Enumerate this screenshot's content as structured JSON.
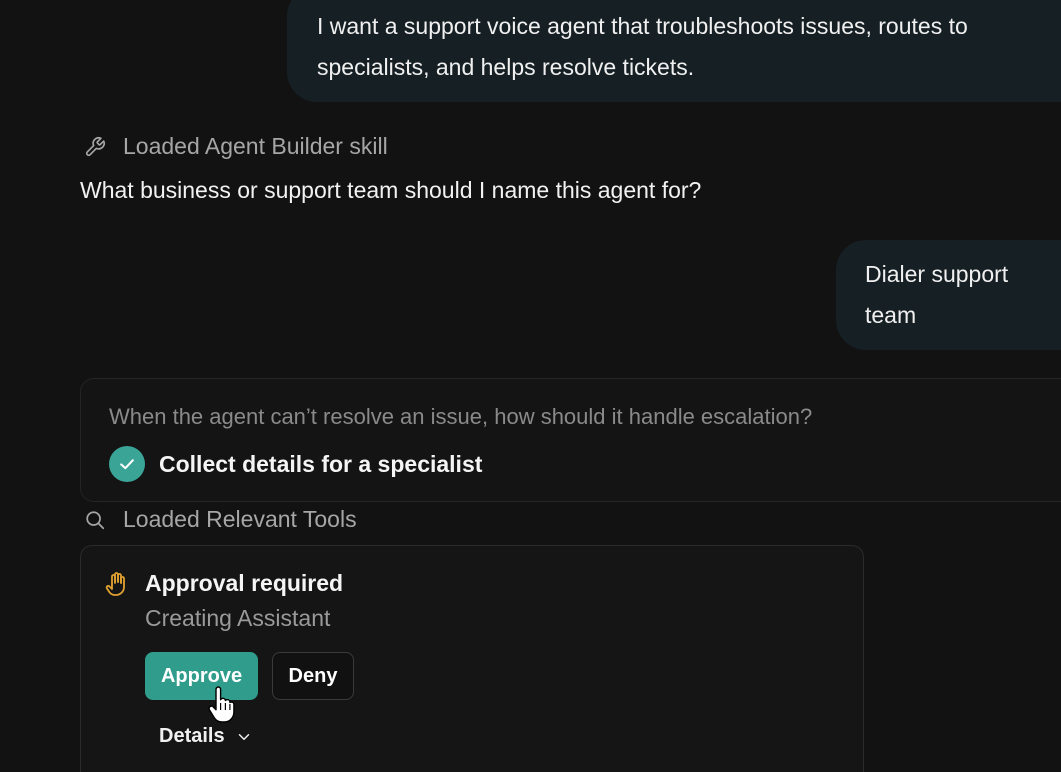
{
  "messages": {
    "user_1": {
      "line1": "I want a support voice agent that troubleshoots issues, routes to",
      "line2": "specialists, and helps resolve tickets."
    },
    "tool_loaded_skill": {
      "label": "Loaded Agent Builder skill",
      "icon": "wrench-icon"
    },
    "assistant_question": "What business or support team should I name this agent for?",
    "user_2": {
      "line1": "Dialer support",
      "line2": "team"
    }
  },
  "escalation_card": {
    "question": "When the agent can’t resolve an issue, how should it handle escalation?",
    "selected_answer": "Collect details for a specialist",
    "check_color": "#3aa596"
  },
  "tool_loaded_tools": {
    "label": "Loaded Relevant Tools",
    "icon": "search-icon"
  },
  "approval": {
    "title": "Approval required",
    "subtitle": "Creating Assistant",
    "icon": "hand-icon",
    "icon_color": "#e0a031",
    "approve_label": "Approve",
    "deny_label": "Deny",
    "details_label": "Details",
    "approve_color": "#2f9c8c"
  }
}
